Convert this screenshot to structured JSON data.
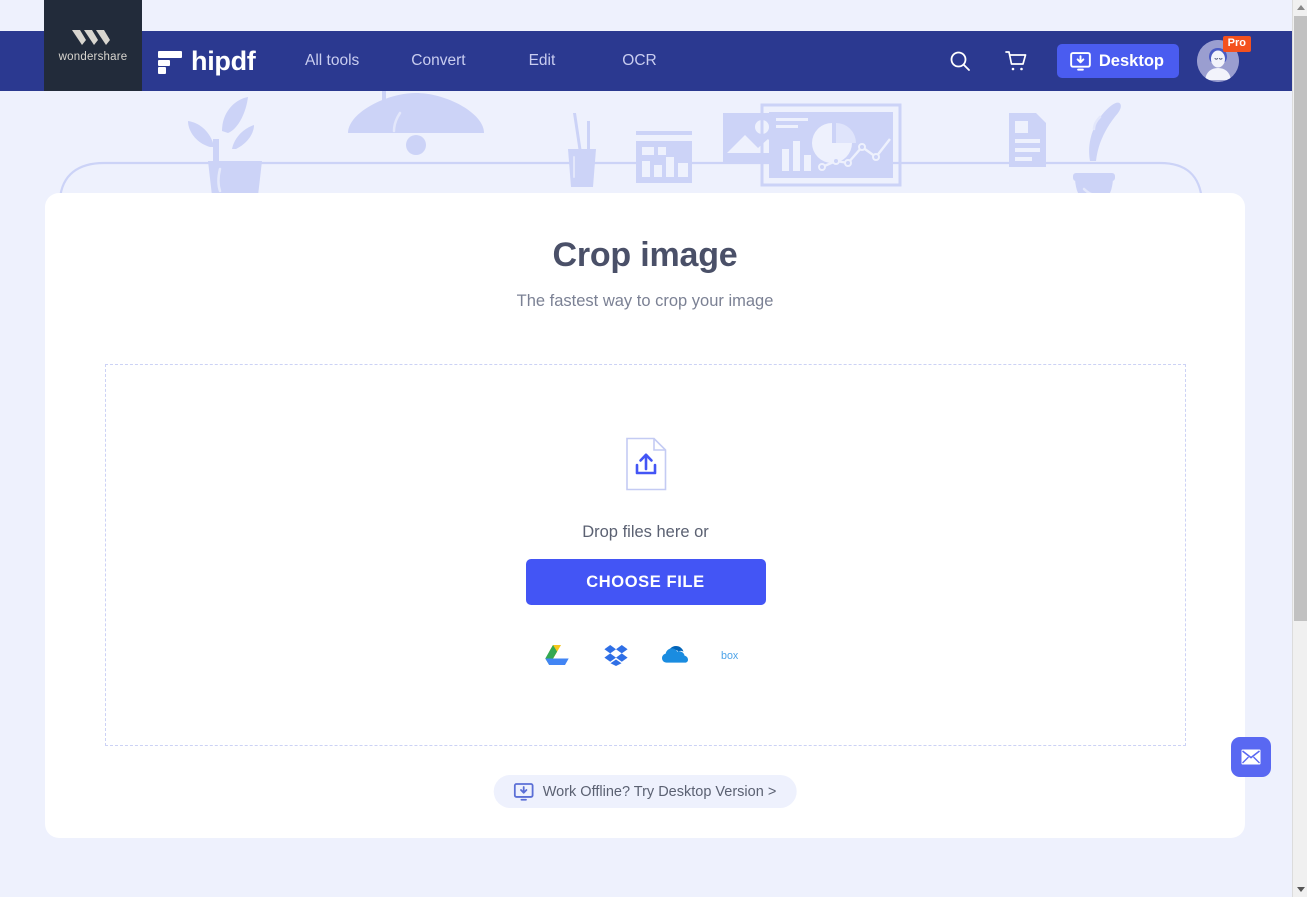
{
  "header": {
    "wondershare_label": "wondershare",
    "wondershare_logo_icon": "wondershare-w-icon",
    "brand_name": "hipdf",
    "brand_logo_icon": "hipdf-mark-icon",
    "nav_items": [
      {
        "label": "All tools"
      },
      {
        "label": "Convert"
      },
      {
        "label": "Edit"
      },
      {
        "label": "OCR"
      }
    ],
    "search_icon": "search-icon",
    "cart_icon": "cart-icon",
    "desktop_button_label": "Desktop",
    "desktop_button_icon": "desktop-download-icon",
    "avatar_icon": "user-avatar",
    "pro_badge_label": "Pro"
  },
  "main": {
    "title": "Crop image",
    "subtitle": "The fastest way to crop your image",
    "dropzone": {
      "upload_icon": "file-upload-icon",
      "drop_text": "Drop files here or",
      "choose_file_label": "CHOOSE FILE",
      "cloud_services": [
        {
          "name": "google-drive-icon"
        },
        {
          "name": "dropbox-icon"
        },
        {
          "name": "onedrive-icon"
        },
        {
          "name": "box-icon"
        }
      ]
    },
    "offline_link": {
      "label": "Work Offline? Try Desktop Version >",
      "icon": "desktop-download-icon"
    }
  },
  "widgets": {
    "mail_icon": "envelope-icon"
  },
  "colors": {
    "navbar": "#2b3990",
    "wondershare_block": "#222b3a",
    "page_background": "#eef1fd",
    "primary_button": "#4355f5",
    "desktop_button": "#4a5cf0",
    "pro_badge": "#f4511e",
    "card": "#ffffff",
    "dropzone_border": "#ccd2f5"
  }
}
